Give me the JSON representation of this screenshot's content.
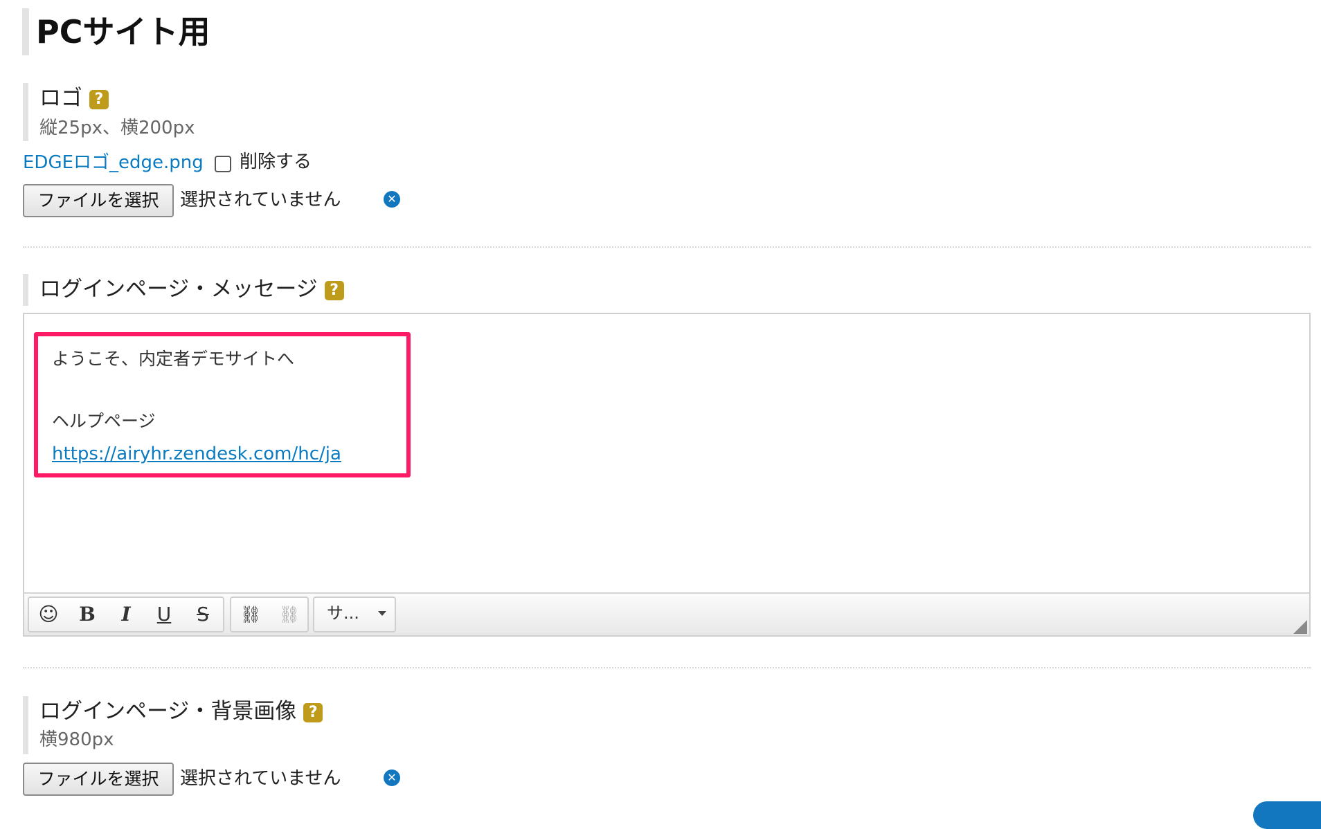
{
  "page": {
    "title": "PCサイト用"
  },
  "logo_section": {
    "title": "ロゴ",
    "help": "?",
    "size_note": "縦25px、横200px",
    "current_file": "EDGEロゴ_edge.png",
    "delete_label": "削除する",
    "choose_button": "ファイルを選択",
    "file_status": "選択されていません"
  },
  "message_section": {
    "title": "ログインページ・メッセージ",
    "help": "?",
    "content": {
      "line1": "ようこそ、内定者デモサイトへ",
      "line2": "ヘルプページ",
      "link": "https://airyhr.zendesk.com/hc/ja"
    },
    "toolbar": {
      "emoji_icon": "☺",
      "bold": "B",
      "italic": "I",
      "underline": "U",
      "strike": "S",
      "link_icon": "⛓",
      "unlink_icon": "⛓",
      "style_select": "サ..."
    }
  },
  "background_section": {
    "title": "ログインページ・背景画像",
    "help": "?",
    "size_note": "横980px",
    "choose_button": "ファイルを選択",
    "file_status": "選択されていません"
  },
  "colors": {
    "accent_link": "#0a7bc1",
    "help_badge": "#bf9b1c",
    "highlight": "#ff1a66",
    "clear_icon": "#1277bf"
  }
}
